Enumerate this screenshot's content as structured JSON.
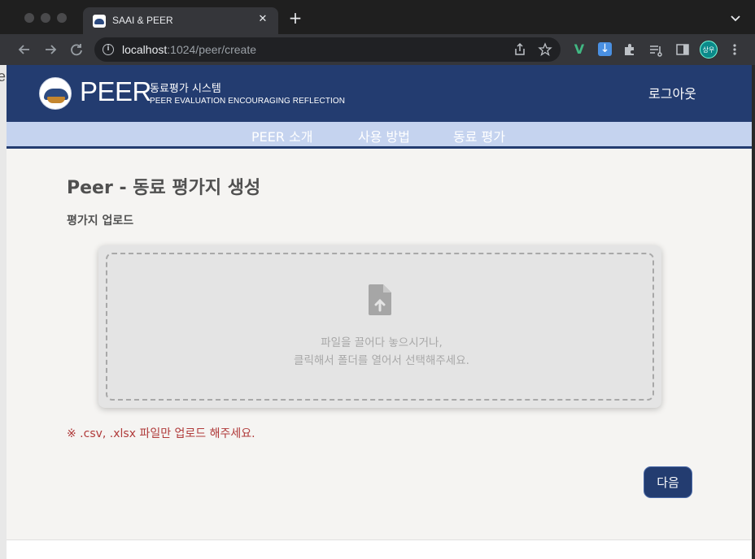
{
  "browser": {
    "tab_title": "SAAI & PEER",
    "tab_close": "✕",
    "new_tab": "+",
    "url_host": "localhost",
    "url_path": ":1024/peer/create",
    "profile_initials": "상우"
  },
  "header": {
    "brand": "PEER",
    "subtitle_kr": "동료평가 시스템",
    "subtitle_en": "PEER EVALUATION ENCOURAGING REFLECTION",
    "logout_label": "로그아웃"
  },
  "nav": {
    "items": [
      {
        "label": "PEER 소개"
      },
      {
        "label": "사용 방법"
      },
      {
        "label": "동료 평가"
      }
    ]
  },
  "main": {
    "title": "Peer - 동료 평가지 생성",
    "section_label": "평가지 업로드",
    "dropzone": {
      "line1": "파일을 끌어다 놓으시거나,",
      "line2": "클릭해서 폴더를 열어서 선택해주세요.",
      "icon": "file-upload-icon"
    },
    "notice": "※ .csv, .xlsx 파일만 업로드 해주세요.",
    "next_label": "다음"
  },
  "colors": {
    "header_bg": "#233c70",
    "nav_bg": "#c5d3ef",
    "notice": "#b03a3a",
    "page_bg": "#f5f4f2"
  }
}
